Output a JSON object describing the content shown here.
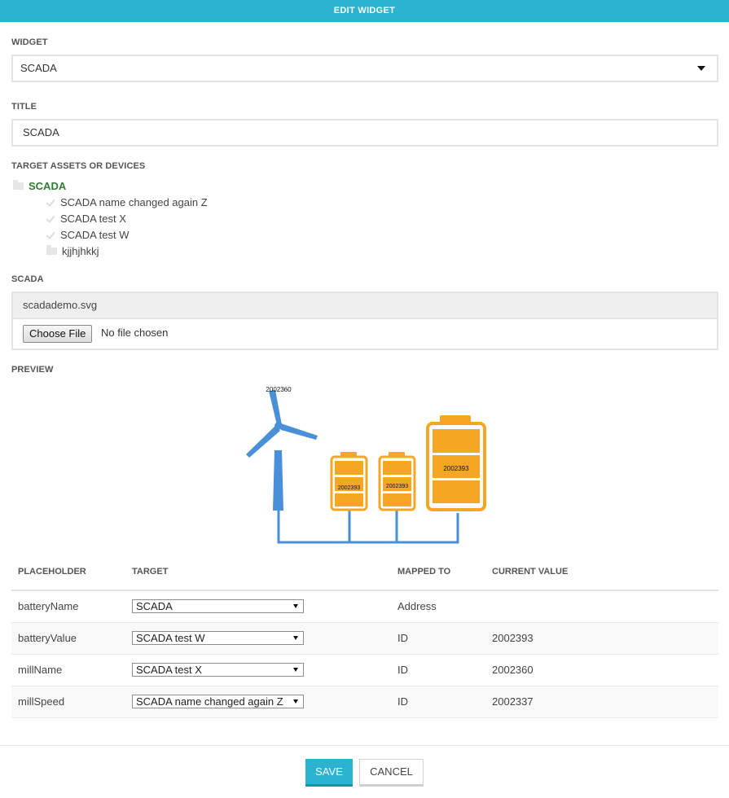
{
  "dialog": {
    "title": "EDIT WIDGET"
  },
  "widget": {
    "label": "WIDGET",
    "value": "SCADA"
  },
  "title_field": {
    "label": "TITLE",
    "value": "SCADA"
  },
  "targets": {
    "label": "TARGET ASSETS OR DEVICES",
    "root": "SCADA",
    "children": [
      {
        "label": "SCADA name changed again Z",
        "icon": "check-icon"
      },
      {
        "label": "SCADA test X",
        "icon": "check-icon"
      },
      {
        "label": "SCADA test W",
        "icon": "check-icon"
      },
      {
        "label": "kjjhjhkkj",
        "icon": "folder-icon"
      }
    ]
  },
  "scada": {
    "label": "SCADA",
    "file_name": "scadademo.svg",
    "choose_label": "Choose File",
    "no_file_text": "No file chosen"
  },
  "preview": {
    "label": "PREVIEW",
    "mill_value": "2002360",
    "battery_values": [
      "2002393",
      "2002393",
      "2002393"
    ],
    "colors": {
      "blue": "#4a90d9",
      "orange": "#f5a623"
    }
  },
  "table": {
    "headers": [
      "PLACEHOLDER",
      "TARGET",
      "MAPPED TO",
      "CURRENT VALUE"
    ],
    "rows": [
      {
        "placeholder": "batteryName",
        "target": "SCADA",
        "mapped_to": "Address",
        "current_value": ""
      },
      {
        "placeholder": "batteryValue",
        "target": "SCADA test W",
        "mapped_to": "ID",
        "current_value": "2002393"
      },
      {
        "placeholder": "millName",
        "target": "SCADA test X",
        "mapped_to": "ID",
        "current_value": "2002360"
      },
      {
        "placeholder": "millSpeed",
        "target": "SCADA name changed again Z",
        "mapped_to": "ID",
        "current_value": "2002337"
      }
    ]
  },
  "buttons": {
    "save": "SAVE",
    "cancel": "CANCEL"
  },
  "colors": {
    "accent": "#2bb3d1",
    "tree_root": "#2e7d32"
  }
}
